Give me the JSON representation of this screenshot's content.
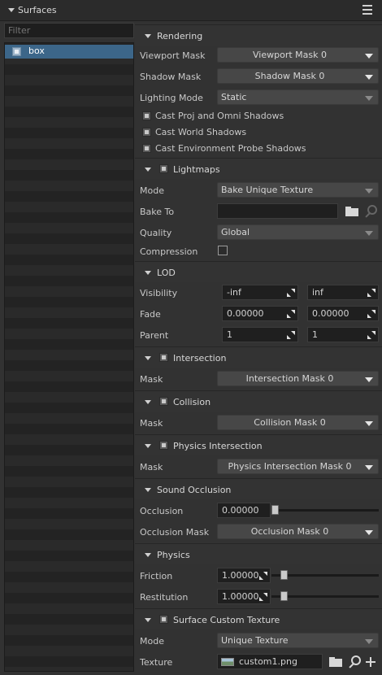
{
  "window": {
    "title": "Surfaces"
  },
  "filter": {
    "placeholder": "Filter"
  },
  "tree": {
    "items": [
      {
        "label": "box"
      }
    ]
  },
  "rendering": {
    "title": "Rendering",
    "viewport_mask": {
      "label": "Viewport Mask",
      "value": "Viewport Mask 0"
    },
    "shadow_mask": {
      "label": "Shadow Mask",
      "value": "Shadow Mask 0"
    },
    "lighting_mode": {
      "label": "Lighting Mode",
      "value": "Static"
    },
    "checks": [
      {
        "label": "Cast Proj and Omni Shadows"
      },
      {
        "label": "Cast World Shadows"
      },
      {
        "label": "Cast Environment Probe Shadows"
      }
    ]
  },
  "lightmaps": {
    "title": "Lightmaps",
    "mode": {
      "label": "Mode",
      "value": "Bake Unique Texture"
    },
    "bake_to": {
      "label": "Bake To",
      "value": ""
    },
    "quality": {
      "label": "Quality",
      "value": "Global"
    },
    "compression": {
      "label": "Compression"
    }
  },
  "lod": {
    "title": "LOD",
    "visibility": {
      "label": "Visibility",
      "min": "-inf",
      "max": "inf"
    },
    "fade": {
      "label": "Fade",
      "min": "0.00000",
      "max": "0.00000"
    },
    "parent": {
      "label": "Parent",
      "min": "1",
      "max": "1"
    }
  },
  "intersection": {
    "title": "Intersection",
    "mask": {
      "label": "Mask",
      "value": "Intersection Mask 0"
    }
  },
  "collision": {
    "title": "Collision",
    "mask": {
      "label": "Mask",
      "value": "Collision Mask 0"
    }
  },
  "physics_intersection": {
    "title": "Physics Intersection",
    "mask": {
      "label": "Mask",
      "value": "Physics Intersection Mask 0"
    }
  },
  "sound_occlusion": {
    "title": "Sound Occlusion",
    "occlusion": {
      "label": "Occlusion",
      "value": "0.00000"
    },
    "occlusion_mask": {
      "label": "Occlusion Mask",
      "value": "Occlusion Mask 0"
    }
  },
  "physics": {
    "title": "Physics",
    "friction": {
      "label": "Friction",
      "value": "1.00000"
    },
    "restitution": {
      "label": "Restitution",
      "value": "1.00000"
    }
  },
  "surface_custom_texture": {
    "title": "Surface Custom Texture",
    "mode": {
      "label": "Mode",
      "value": "Unique Texture"
    },
    "texture": {
      "label": "Texture",
      "value": "custom1.png"
    }
  }
}
